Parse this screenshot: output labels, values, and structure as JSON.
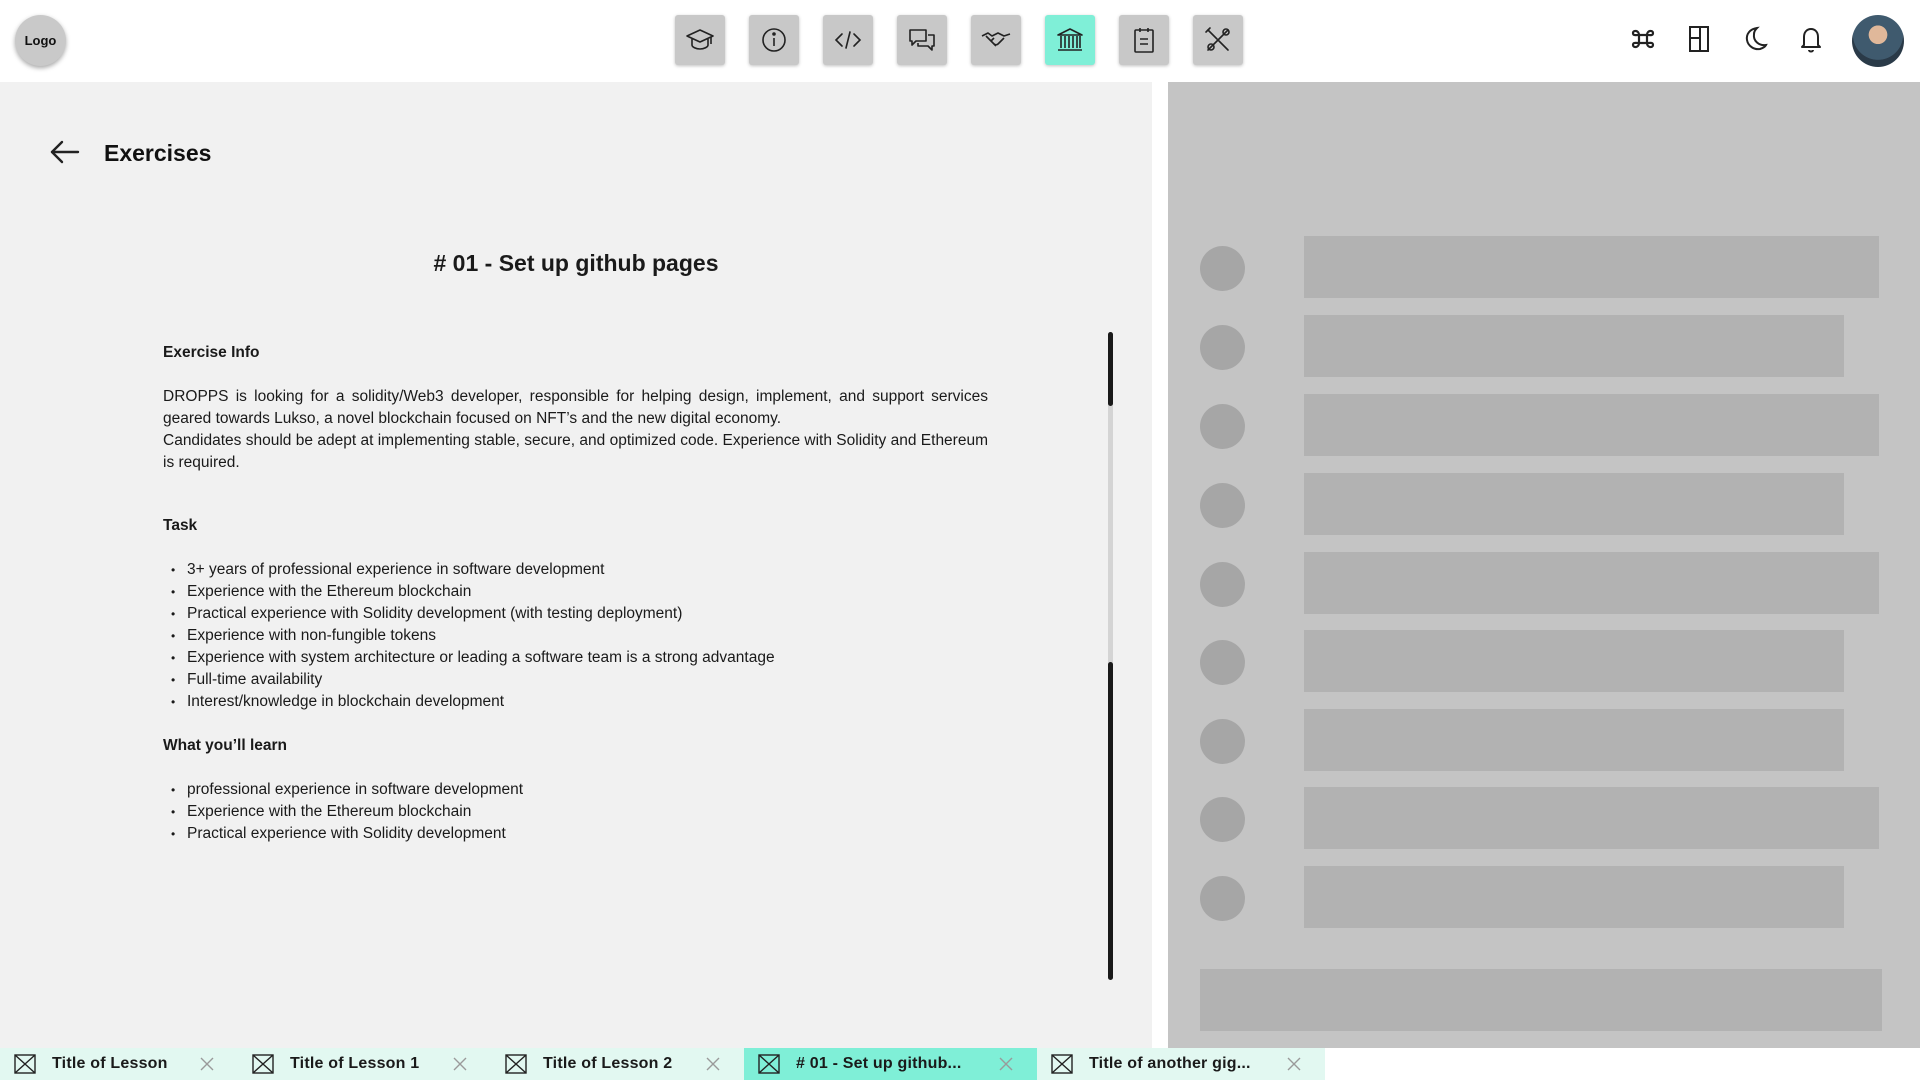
{
  "header": {
    "logo_label": "Logo",
    "nav_items": [
      {
        "icon": "graduation-cap-icon",
        "active": false
      },
      {
        "icon": "info-icon",
        "active": false
      },
      {
        "icon": "code-icon",
        "active": false
      },
      {
        "icon": "chat-icon",
        "active": false
      },
      {
        "icon": "handshake-icon",
        "active": false
      },
      {
        "icon": "bank-icon",
        "active": true
      },
      {
        "icon": "clipboard-icon",
        "active": false
      },
      {
        "icon": "tools-icon",
        "active": false
      }
    ],
    "right_icons": [
      "command-icon",
      "layout-icon",
      "moon-icon",
      "bell-icon"
    ],
    "accent_color": "#7fefd7"
  },
  "main": {
    "title": "Exercises",
    "exercise_title": "# 01 - Set up github pages",
    "sections": {
      "info_heading": "Exercise Info",
      "info_para_1": "DROPPS is looking for a solidity/Web3 developer, responsible for helping design, implement, and support services geared towards Lukso, a novel blockchain focused on NFT’s and the new digital economy.",
      "info_para_2": "Candidates should be adept at implementing stable, secure, and optimized code. Experience with Solidity and Ethereum is required.",
      "task_heading": "Task",
      "task_items": [
        "3+ years of professional experience in software development",
        "Experience with the Ethereum blockchain",
        "Practical experience with Solidity development (with testing deployment)",
        "Experience with non-fungible tokens",
        "Experience with system architecture or leading a software team is a strong advantage",
        "Full-time availability",
        "Interest/knowledge in blockchain development"
      ],
      "learn_heading": "What you’ll learn",
      "learn_items": [
        "professional experience in software development",
        "Experience with the Ethereum blockchain",
        "Practical experience with Solidity development"
      ]
    }
  },
  "bottom_tabs": [
    {
      "label": "Title of Lesson",
      "active": false
    },
    {
      "label": "Title of Lesson 1",
      "active": false
    },
    {
      "label": "Title of Lesson 2",
      "active": false
    },
    {
      "label": "# 01 - Set up github...",
      "active": true
    },
    {
      "label": "Title of another gig...",
      "active": false
    }
  ]
}
